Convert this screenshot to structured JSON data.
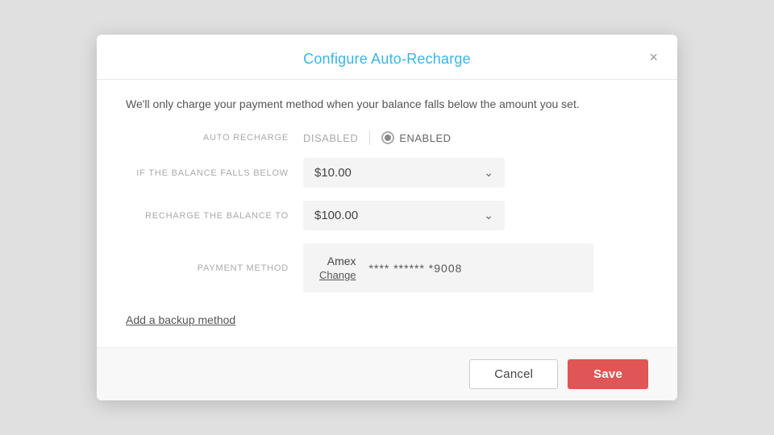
{
  "modal": {
    "title": "Configure Auto-Recharge",
    "close_label": "×",
    "description": "We'll only charge your payment method when your balance falls below the amount you set.",
    "auto_recharge": {
      "label": "AUTO RECHARGE",
      "disabled_label": "DISABLED",
      "enabled_label": "ENABLED",
      "state": "enabled"
    },
    "balance_falls_below": {
      "label": "IF THE BALANCE FALLS BELOW",
      "value": "$10.00"
    },
    "recharge_balance_to": {
      "label": "RECHARGE THE BALANCE TO",
      "value": "$100.00"
    },
    "payment_method": {
      "label": "PAYMENT METHOD",
      "brand": "Amex",
      "change_label": "Change",
      "card_number": "**** ****** *9008"
    },
    "backup_link": "Add a backup method"
  },
  "footer": {
    "cancel_label": "Cancel",
    "save_label": "Save"
  }
}
